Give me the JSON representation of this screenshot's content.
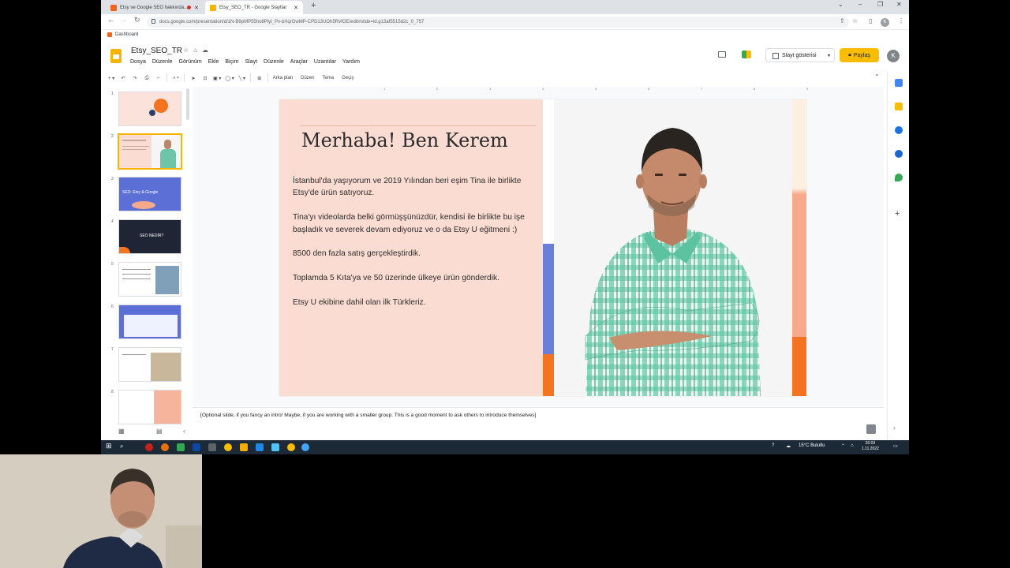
{
  "browser": {
    "tabs": [
      {
        "label": "Etsy ve Google SEO hakkında...",
        "active": false
      },
      {
        "label": "Etsy_SEO_TR - Google Slaytlar",
        "active": true
      }
    ],
    "url": "docs.google.com/presentation/d/1N-B9pMP55ho8PlyI_Pv-bXqrGwMP-CPD13UOh5RvfOE/edit#slide=id.g13af5515d2c_0_757",
    "bookmark": "Dashboard",
    "profile_initial": "K"
  },
  "app": {
    "doc_title": "Etsy_SEO_TR",
    "menu": [
      "Dosya",
      "Düzenle",
      "Görünüm",
      "Ekle",
      "Biçim",
      "Slayt",
      "Düzenle",
      "Araçlar",
      "Uzantılar",
      "Yardım"
    ],
    "present_label": "Slayt gösterisi",
    "share_label": "Paylaş",
    "account_initial": "K",
    "toolbar_text": [
      "Arka plan",
      "Düzen",
      "Tema",
      "Geçiş"
    ]
  },
  "filmstrip": {
    "numbers": [
      "1",
      "2",
      "3",
      "4",
      "5",
      "6",
      "7",
      "8"
    ],
    "slide3_text": "SEO: Etsy & Google",
    "slide4_text": "SEO NEDİR?"
  },
  "ruler_ticks": [
    "1",
    "2",
    "3",
    "4",
    "5",
    "6",
    "7",
    "8",
    "9"
  ],
  "slide": {
    "title": "Merhaba! Ben Kerem",
    "paragraphs": [
      "İstanbul'da yaşıyorum ve 2019 Yılından beri eşim Tina ile birlikte Etsy'de ürün satıyoruz.",
      "Tina'yı videolarda belki görmüşşünüzdür, kendisi ile birlikte bu işe başladık ve severek devam ediyoruz ve o da Etsy U eğitmeni :)",
      "8500 den fazla satış gerçekleştirdik.",
      "Toplamda 5 Kıta'ya ve 50 üzerinde ülkeye ürün gönderdik.",
      "Etsy U ekibine dahil olan ilk Türkleriz."
    ]
  },
  "notes": "[Optional slide, if you fancy an intro! Maybe, if you are working with a smaller group. This is a good moment to ask others to introduce themselves]",
  "taskbar": {
    "weather": "15°C Bulutlu",
    "time": "20:03",
    "date": "1.11.2022"
  },
  "colors": {
    "accent": "#fbbc04",
    "slide_pink": "#fbdcd2",
    "stripe_blue": "#6a7fd8",
    "stripe_orange": "#f37320"
  }
}
